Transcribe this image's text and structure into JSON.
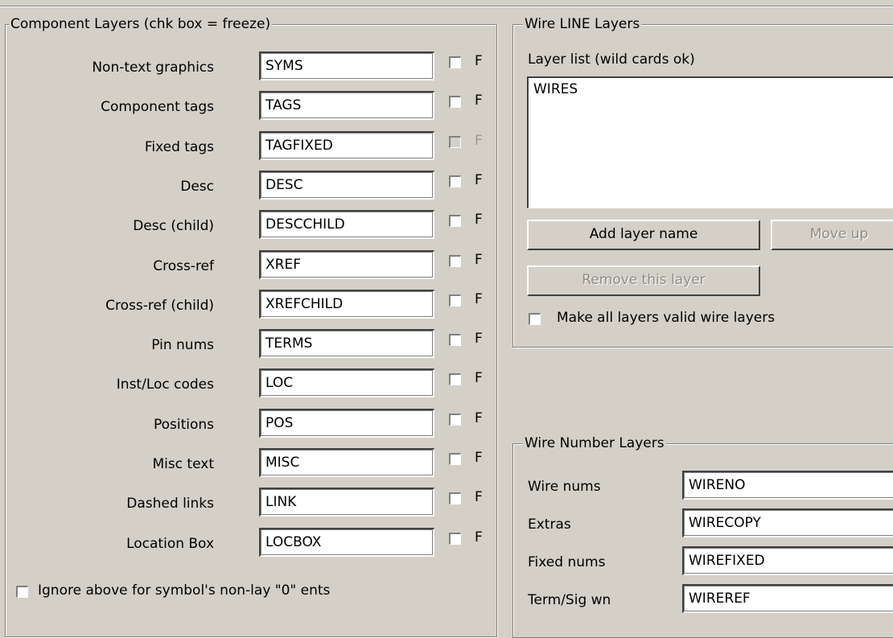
{
  "component_layers": {
    "title": "Component Layers (chk box = freeze)",
    "rows": [
      {
        "label": "Non-text graphics",
        "value": "SYMS",
        "freeze_label": "F",
        "enabled": true
      },
      {
        "label": "Component tags",
        "value": "TAGS",
        "freeze_label": "F",
        "enabled": true
      },
      {
        "label": "Fixed tags",
        "value": "TAGFIXED",
        "freeze_label": "F",
        "enabled": false
      },
      {
        "label": "Desc",
        "value": "DESC",
        "freeze_label": "F",
        "enabled": true
      },
      {
        "label": "Desc (child)",
        "value": "DESCCHILD",
        "freeze_label": "F",
        "enabled": true
      },
      {
        "label": "Cross-ref",
        "value": "XREF",
        "freeze_label": "F",
        "enabled": true
      },
      {
        "label": "Cross-ref (child)",
        "value": "XREFCHILD",
        "freeze_label": "F",
        "enabled": true
      },
      {
        "label": "Pin nums",
        "value": "TERMS",
        "freeze_label": "F",
        "enabled": true
      },
      {
        "label": "Inst/Loc codes",
        "value": "LOC",
        "freeze_label": "F",
        "enabled": true
      },
      {
        "label": "Positions",
        "value": "POS",
        "freeze_label": "F",
        "enabled": true
      },
      {
        "label": "Misc text",
        "value": "MISC",
        "freeze_label": "F",
        "enabled": true
      },
      {
        "label": "Dashed links",
        "value": "LINK",
        "freeze_label": "F",
        "enabled": true
      },
      {
        "label": "Location Box",
        "value": "LOCBOX",
        "freeze_label": "F",
        "enabled": true
      }
    ],
    "ignore_label": "Ignore above for symbol's non-lay \"0\" ents"
  },
  "wire_line_layers": {
    "title": "Wire LINE Layers",
    "list_label": "Layer list (wild cards ok)",
    "list_items": [
      "WIRES"
    ],
    "add_button": "Add layer name",
    "move_up_button": "Move up",
    "remove_button": "Remove this layer",
    "make_all_label": "Make all layers valid wire layers"
  },
  "wire_number_layers": {
    "title": "Wire Number Layers",
    "rows": [
      {
        "label": "Wire nums",
        "value": "WIRENO"
      },
      {
        "label": "Extras",
        "value": "WIRECOPY"
      },
      {
        "label": "Fixed nums",
        "value": "WIREFIXED"
      },
      {
        "label": "Term/Sig wn",
        "value": "WIREREF"
      }
    ]
  }
}
